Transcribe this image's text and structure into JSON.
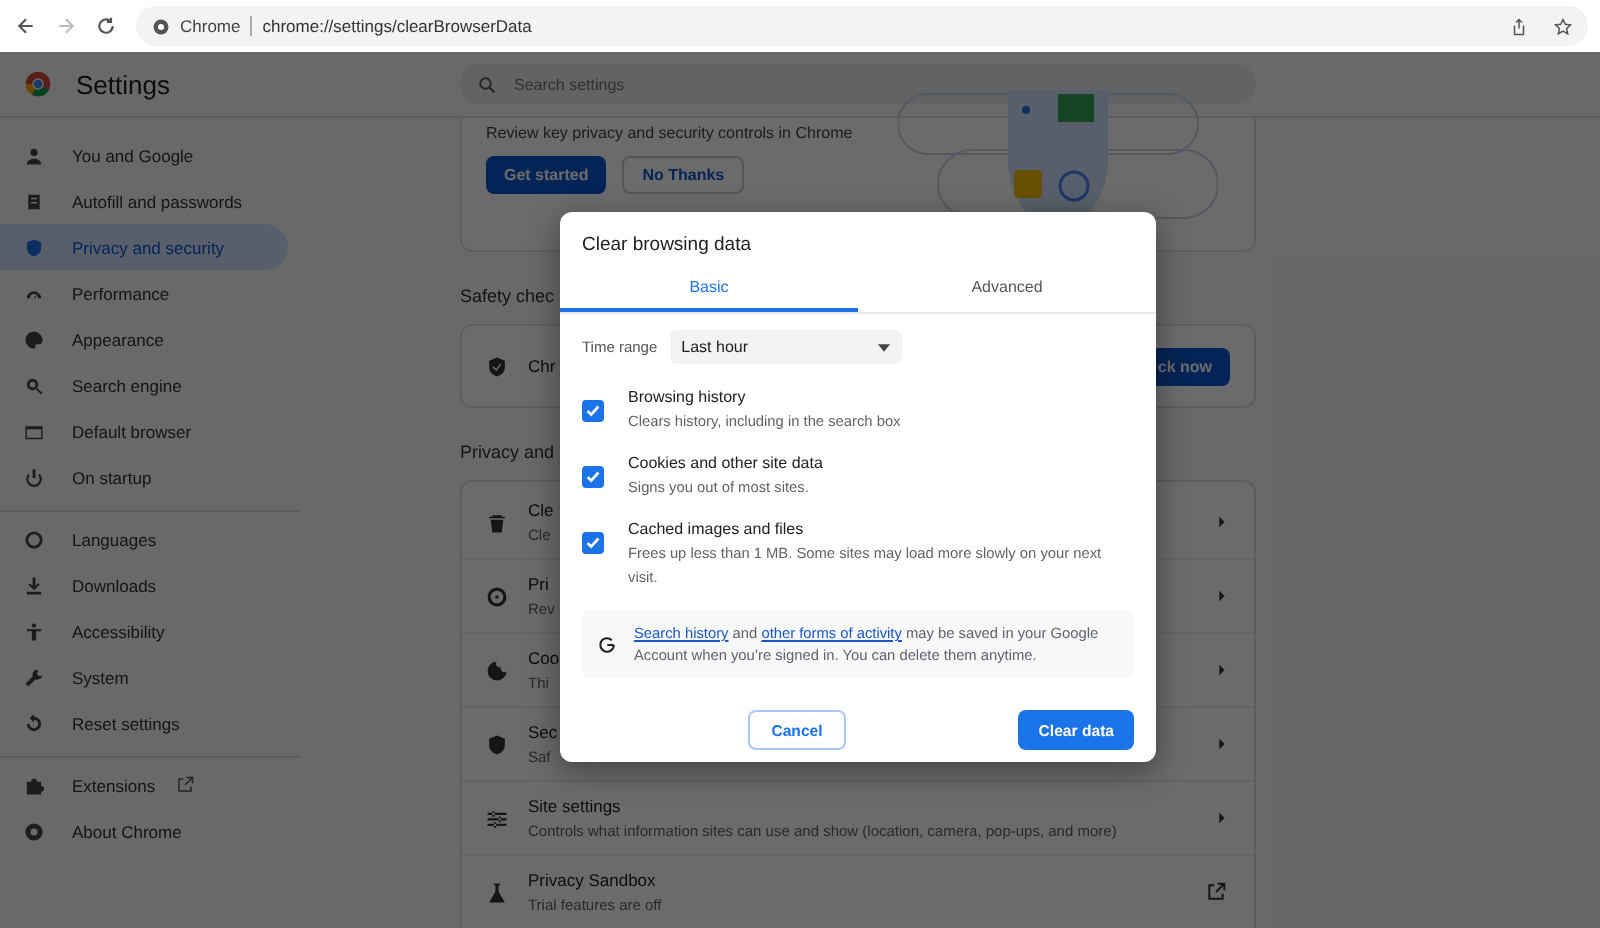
{
  "browser": {
    "site_label": "Chrome",
    "url": "chrome://settings/clearBrowserData"
  },
  "header": {
    "title": "Settings",
    "search_placeholder": "Search settings"
  },
  "sidebar": {
    "sections": [
      [
        {
          "label": "You and Google",
          "selected": false,
          "external": false
        },
        {
          "label": "Autofill and passwords",
          "selected": false,
          "external": false
        },
        {
          "label": "Privacy and security",
          "selected": true,
          "external": false
        },
        {
          "label": "Performance",
          "selected": false,
          "external": false
        },
        {
          "label": "Appearance",
          "selected": false,
          "external": false
        },
        {
          "label": "Search engine",
          "selected": false,
          "external": false
        },
        {
          "label": "Default browser",
          "selected": false,
          "external": false
        },
        {
          "label": "On startup",
          "selected": false,
          "external": false
        }
      ],
      [
        {
          "label": "Languages",
          "selected": false,
          "external": false
        },
        {
          "label": "Downloads",
          "selected": false,
          "external": false
        },
        {
          "label": "Accessibility",
          "selected": false,
          "external": false
        },
        {
          "label": "System",
          "selected": false,
          "external": false
        },
        {
          "label": "Reset settings",
          "selected": false,
          "external": false
        }
      ],
      [
        {
          "label": "Extensions",
          "selected": false,
          "external": true
        },
        {
          "label": "About Chrome",
          "selected": false,
          "external": false
        }
      ]
    ]
  },
  "main": {
    "promo": {
      "text": "Review key privacy and security controls in Chrome",
      "buttons": [
        {
          "label": "Get started",
          "kind": "primary"
        },
        {
          "label": "No Thanks",
          "kind": "secondary"
        }
      ]
    },
    "safety_check": {
      "heading": "Safety chec",
      "row_text": "Chr",
      "button": "ck now"
    },
    "privacy": {
      "heading": "Privacy and",
      "rows": [
        {
          "title": "Cle",
          "subtitle": "Cle",
          "external": false
        },
        {
          "title": "Pri",
          "subtitle": "Rev",
          "external": false
        },
        {
          "title": "Coo",
          "subtitle": "Thi",
          "external": false
        },
        {
          "title": "Sec",
          "subtitle": "Saf",
          "external": false
        },
        {
          "title": "Site settings",
          "subtitle": "Controls what information sites can use and show (location, camera, pop-ups, and more)",
          "external": false
        },
        {
          "title": "Privacy Sandbox",
          "subtitle": "Trial features are off",
          "external": true
        }
      ]
    }
  },
  "dialog": {
    "title": "Clear browsing data",
    "tabs": [
      {
        "label": "Basic",
        "selected": true
      },
      {
        "label": "Advanced",
        "selected": false
      }
    ],
    "time_range": {
      "label": "Time range",
      "value": "Last hour"
    },
    "options": [
      {
        "title": "Browsing history",
        "description": "Clears history, including in the search box",
        "checked": true
      },
      {
        "title": "Cookies and other site data",
        "description": "Signs you out of most sites.",
        "checked": true
      },
      {
        "title": "Cached images and files",
        "description": "Frees up less than 1 MB. Some sites may load more slowly on your next visit.",
        "checked": true
      }
    ],
    "notice": [
      {
        "kind": "link",
        "text": "Search history"
      },
      {
        "kind": "text",
        "text": " and "
      },
      {
        "kind": "link",
        "text": "other forms of activity"
      },
      {
        "kind": "text",
        "text": " may be saved in your Google Account when you’re signed in. You can delete them anytime."
      }
    ],
    "buttons": [
      {
        "label": "Cancel",
        "kind": "secondary"
      },
      {
        "label": "Clear data",
        "kind": "primary"
      }
    ]
  }
}
